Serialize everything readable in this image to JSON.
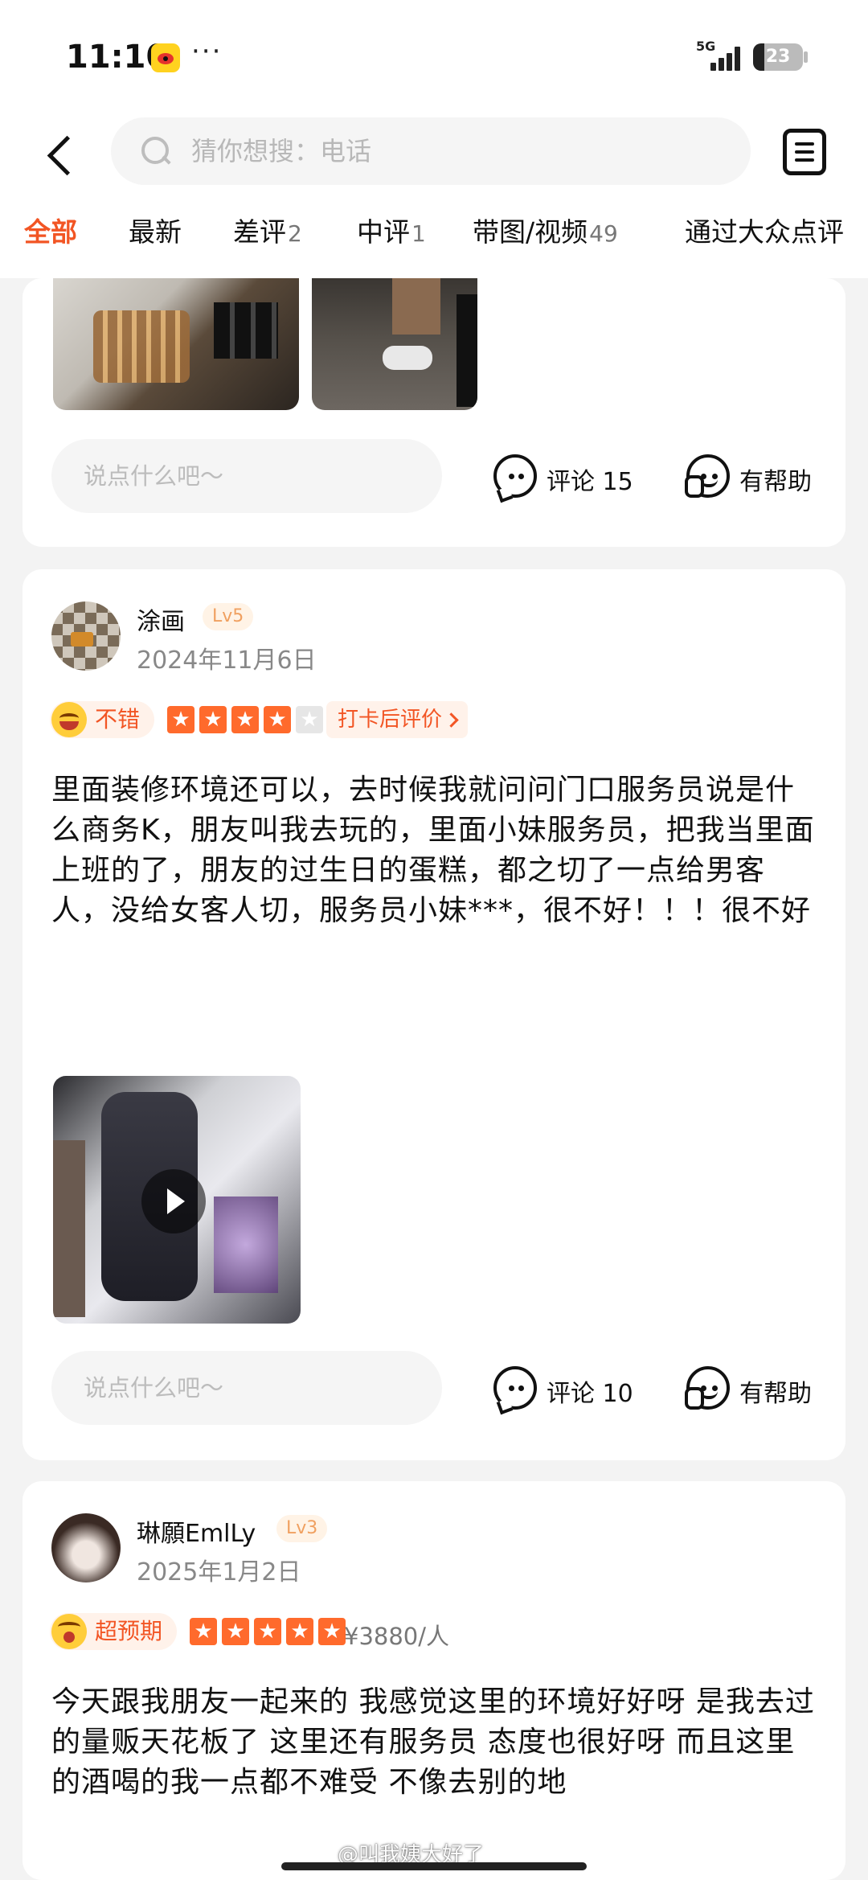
{
  "status_bar": {
    "time": "11:10",
    "more": "···",
    "network": "5G",
    "battery": "23",
    "battery_level": 0.23
  },
  "search": {
    "placeholder": "猜你想搜：电话"
  },
  "tabs": [
    {
      "label": "全部",
      "count": ""
    },
    {
      "label": "最新",
      "count": ""
    },
    {
      "label": "差评",
      "count": "2"
    },
    {
      "label": "中评",
      "count": "1"
    },
    {
      "label": "带图/视频",
      "count": "49"
    },
    {
      "label": "通过大众点评",
      "count": ""
    }
  ],
  "review_prev": {
    "comment_placeholder": "说点什么吧～",
    "comment_label": "评论 15",
    "helpful_label": "有帮助"
  },
  "review_1": {
    "username": "涂画",
    "level": "Lv5",
    "date": "2024年11月6日",
    "rating_tag": "不错",
    "stars": 4,
    "checkin_label": "打卡后评价",
    "text": "里面装修环境还可以，去时候我就问问门口服务员说是什么商务K，朋友叫我去玩的，里面小妹服务员，把我当里面上班的了，朋友的过生日的蛋糕，都之切了一点给男客人，没给女客人切，服务员小妹***，很不好！！！很不好",
    "comment_placeholder": "说点什么吧～",
    "comment_label": "评论 10",
    "helpful_label": "有帮助"
  },
  "review_2": {
    "username": "琳願EmlLy",
    "level": "Lv3",
    "date": "2025年1月2日",
    "rating_tag": "超预期",
    "stars": 5,
    "price": "¥3880/人",
    "text": "今天跟我朋友一起来的 我感觉这里的环境好好呀 是我去过的量贩天花板了 这里还有服务员 态度也很好呀 而且这里的酒喝的我一点都不难受 不像去别的地"
  },
  "watermark": "@叫我姨大好了",
  "colors": {
    "accent": "#f25524",
    "star": "#ff6a2c",
    "background": "#f3f3f3"
  }
}
